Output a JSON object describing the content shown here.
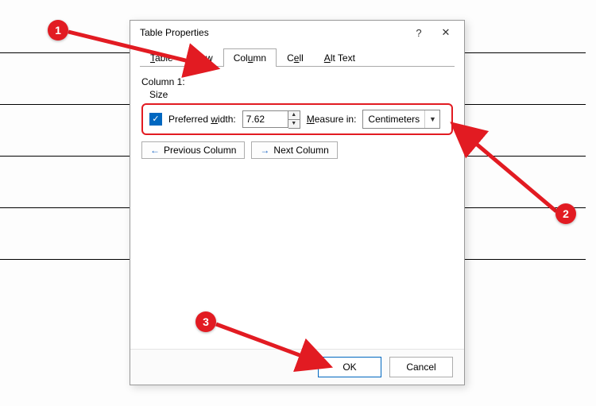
{
  "dialog": {
    "title": "Table Properties",
    "help_label": "?",
    "close_label": "✕"
  },
  "tabs": {
    "table": "able",
    "table_u": "T",
    "row": "o",
    "row_u": "R",
    "row_suffix": "w",
    "column": "Col",
    "column_u": "u",
    "column_suffix": "mn",
    "cell": "C",
    "cell_u": "e",
    "cell_suffix": "ll",
    "alt": "lt Text",
    "alt_u": "A"
  },
  "panel": {
    "heading": "Column 1:",
    "size_label": "Size",
    "pref_width_label": "Preferred ",
    "pref_width_u": "w",
    "pref_width_suffix": "idth:",
    "width_value": "7.62",
    "measure_label_u": "M",
    "measure_label": "easure in:",
    "measure_value": "Centimeters",
    "prev_label_u": "P",
    "prev_label": "revious Column",
    "next_label_u": "N",
    "next_label": "ext Column"
  },
  "footer": {
    "ok": "OK",
    "cancel": "Cancel"
  },
  "annotations": {
    "n1": "1",
    "n2": "2",
    "n3": "3"
  }
}
